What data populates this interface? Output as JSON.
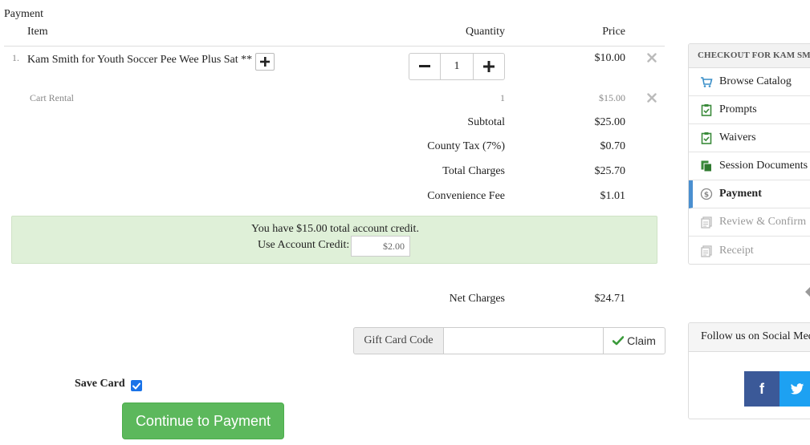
{
  "page": {
    "title": "Payment"
  },
  "cart": {
    "headers": {
      "item": "Item",
      "quantity": "Quantity",
      "price": "Price"
    },
    "items": [
      {
        "index": "1.",
        "name": "Kam Smith for Youth Soccer Pee Wee Plus Sat **",
        "quantity": "1",
        "price": "$10.00"
      },
      {
        "name": "Cart Rental",
        "quantity": "1",
        "price": "$15.00"
      }
    ],
    "totals": [
      {
        "label": "Subtotal",
        "value": "$25.00"
      },
      {
        "label": "County Tax (7%)",
        "value": "$0.70"
      },
      {
        "label": "Total Charges",
        "value": "$25.70"
      },
      {
        "label": "Convenience Fee",
        "value": "$1.01"
      }
    ],
    "net": {
      "label": "Net Charges",
      "value": "$24.71"
    }
  },
  "credit": {
    "message": "You have $15.00 total account credit.",
    "label": "Use Account Credit:",
    "value": "$2.00"
  },
  "gift": {
    "addon": "Gift Card Code",
    "value": "",
    "claim_label": "Claim"
  },
  "save_card": {
    "label": "Save Card",
    "checked": true
  },
  "continue_label": "Continue to Payment",
  "sidebar": {
    "header": "CHECKOUT FOR KAM SMITH",
    "items": [
      {
        "label": "Browse Catalog",
        "icon": "cart-icon",
        "state": "normal"
      },
      {
        "label": "Prompts",
        "icon": "clipboard-check-icon",
        "state": "normal"
      },
      {
        "label": "Waivers",
        "icon": "clipboard-check-icon",
        "state": "normal"
      },
      {
        "label": "Session Documents",
        "icon": "documents-icon",
        "state": "normal"
      },
      {
        "label": "Payment",
        "icon": "dollar-circle-icon",
        "state": "active"
      },
      {
        "label": "Review & Confirm",
        "icon": "receipt-icon",
        "state": "disabled"
      },
      {
        "label": "Receipt",
        "icon": "receipt-icon",
        "state": "disabled"
      }
    ]
  },
  "social": {
    "header": "Follow us on Social Media",
    "facebook_glyph": "f"
  },
  "colors": {
    "primary": "#5cb85c",
    "credit_bg": "#dff0d8",
    "active_accent": "#4a8fd0",
    "facebook": "#3b5998",
    "twitter": "#1da1f2"
  }
}
